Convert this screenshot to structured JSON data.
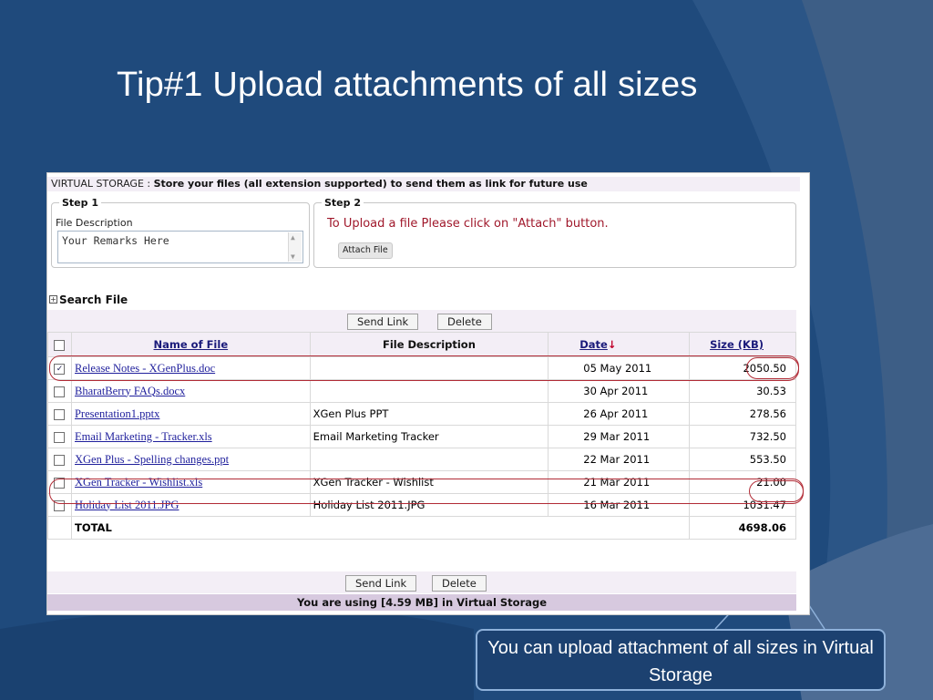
{
  "slide": {
    "title": "Tip#1 Upload attachments of all sizes",
    "callout": "You can upload attachment of all sizes in Virtual Storage"
  },
  "vs": {
    "header_prefix": "VIRTUAL STORAGE : ",
    "header_bold": "Store your files (all extension supported) to send them as link for future use",
    "step1": {
      "legend": "Step 1",
      "label": "File Description",
      "remarks": "Your Remarks Here"
    },
    "step2": {
      "legend": "Step 2",
      "text": "To Upload a file Please click on \"Attach\" button.",
      "attach_label": "Attach File"
    },
    "search_label": "Search File",
    "send_link_label": "Send Link",
    "delete_label": "Delete",
    "usage_text": "You are using [4.59 MB] in Virtual Storage"
  },
  "table": {
    "headers": {
      "name": "Name of File",
      "description": "File Description",
      "date": "Date",
      "size": "Size (KB)"
    },
    "rows": [
      {
        "name": "Release Notes - XGenPlus.doc",
        "description": "",
        "date": "05 May 2011",
        "size": "2050.50",
        "checked": true
      },
      {
        "name": "BharatBerry FAQs.docx",
        "description": "",
        "date": "30 Apr 2011",
        "size": "30.53",
        "checked": false
      },
      {
        "name": "Presentation1.pptx",
        "description": "XGen Plus PPT",
        "date": "26 Apr 2011",
        "size": "278.56",
        "checked": false
      },
      {
        "name": "Email Marketing - Tracker.xls",
        "description": "Email Marketing Tracker",
        "date": "29 Mar 2011",
        "size": "732.50",
        "checked": false
      },
      {
        "name": "XGen Plus - Spelling changes.ppt",
        "description": "",
        "date": "22 Mar 2011",
        "size": "553.50",
        "checked": false
      },
      {
        "name": "XGen Tracker - Wishlist.xls",
        "description": "XGen Tracker - Wishlist",
        "date": "21 Mar 2011",
        "size": "21.00",
        "checked": false
      },
      {
        "name": "Holiday List 2011.JPG",
        "description": "Holiday List 2011.JPG",
        "date": "16 Mar 2011",
        "size": "1031.47",
        "checked": false
      }
    ],
    "total_label": "TOTAL",
    "total_size": "4698.06"
  },
  "colors": {
    "slide_bg": "#1f4a7c",
    "highlight": "#b12b36",
    "callout_border": "#8eb1da"
  }
}
